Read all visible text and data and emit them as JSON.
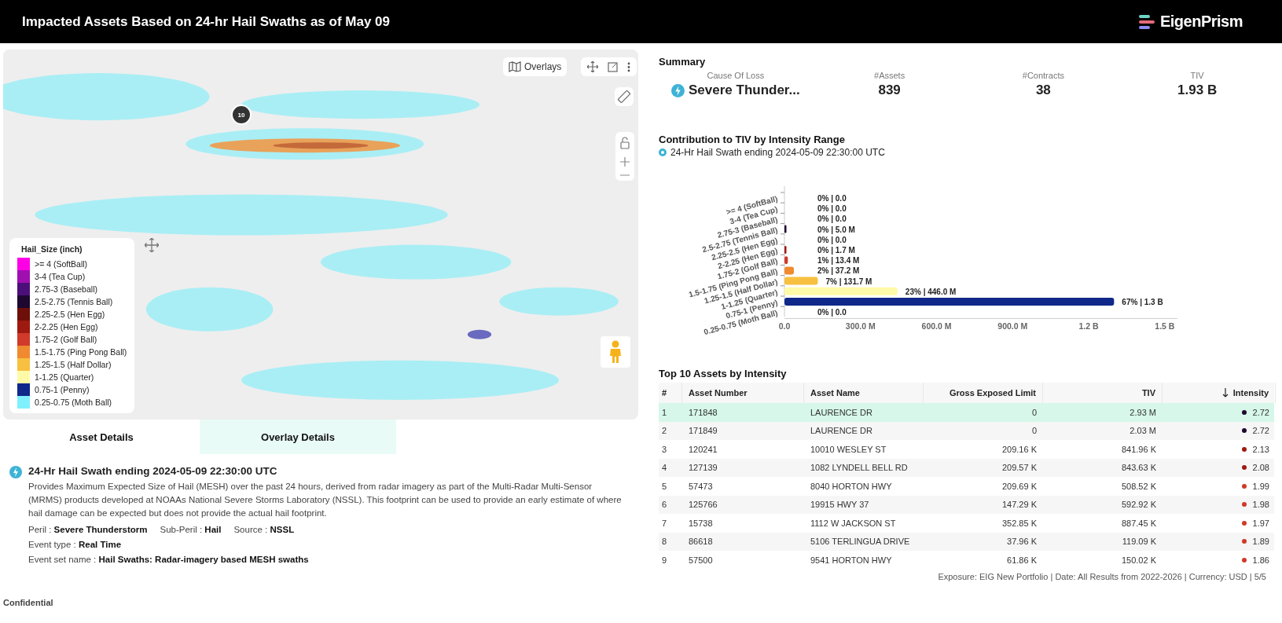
{
  "header": {
    "title": "Impacted Assets Based on 24-hr Hail Swaths as of May 09",
    "logo_text": "EigenPrism"
  },
  "map": {
    "overlays_button": "Overlays",
    "marker_label": "10",
    "legend": {
      "title": "Hail_Size (inch)",
      "items": [
        {
          "label": ">= 4 (SoftBall)",
          "color": "#ff00e6"
        },
        {
          "label": "3-4 (Tea Cup)",
          "color": "#a010b0"
        },
        {
          "label": "2.75-3 (Baseball)",
          "color": "#4b0f7a"
        },
        {
          "label": "2.5-2.75 (Tennis Ball)",
          "color": "#1e0830"
        },
        {
          "label": "2.25-2.5 (Hen Egg)",
          "color": "#6e0f0a"
        },
        {
          "label": "2-2.25 (Hen Egg)",
          "color": "#9e1a10"
        },
        {
          "label": "1.75-2 (Golf Ball)",
          "color": "#d03a2a"
        },
        {
          "label": "1.5-1.75 (Ping Pong Ball)",
          "color": "#f08a30"
        },
        {
          "label": "1.25-1.5 (Half Dollar)",
          "color": "#f7c040"
        },
        {
          "label": "1-1.25 (Quarter)",
          "color": "#fffaa8"
        },
        {
          "label": "0.75-1 (Penny)",
          "color": "#10288a"
        },
        {
          "label": "0.25-0.75 (Moth Ball)",
          "color": "#80f0ff"
        }
      ]
    }
  },
  "detail_tabs": [
    {
      "label": "Asset Details",
      "selected": false
    },
    {
      "label": "Overlay Details",
      "selected": true
    }
  ],
  "overlay_details": {
    "title": "24-Hr Hail Swath ending 2024-05-09 22:30:00 UTC",
    "description": "Provides Maximum Expected Size of Hail (MESH) over the past 24 hours, derived from radar imagery as part of the Multi-Radar Multi-Sensor (MRMS) products developed at NOAAs National Severe Storms Laboratory (NSSL). This footprint can be used to provide an early estimate of where hail damage can be expected but does not provide the actual hail footprint.",
    "facts": [
      [
        "Peril : **Severe Thunderstorm**",
        "Sub-Peril : **Hail**",
        "Source : **NSSL**"
      ],
      [
        "Event type : **Real Time**"
      ],
      [
        "Event set name : **Hail Swaths: Radar-imagery based MESH swaths**"
      ]
    ]
  },
  "footer_left": "Confidential",
  "summary": {
    "title": "Summary",
    "stats": [
      {
        "label": "Cause Of Loss",
        "value": "Severe Thunder...",
        "kind": "peril"
      },
      {
        "label": "#Assets",
        "value": "839",
        "kind": "number"
      },
      {
        "label": "#Contracts",
        "value": "38",
        "kind": "number"
      },
      {
        "label": "TIV",
        "value": "1.93 B",
        "kind": "number"
      }
    ]
  },
  "tiv_chart": {
    "title": "Contribution to TIV by Intensity Range",
    "subtitle": "24-Hr Hail Swath ending 2024-05-09 22:30:00 UTC",
    "chart_data": {
      "type": "bar",
      "orientation": "horizontal",
      "categories": [
        ">= 4 (SoftBall)",
        "3-4 (Tea Cup)",
        "2.75-3 (Baseball)",
        "2.5-2.75 (Tennis Ball)",
        "2.25-2.5 (Hen Egg)",
        "2-2.25 (Hen Egg)",
        "1.75-2 (Golf Ball)",
        "1.5-1.75 (Ping Pong Ball)",
        "1.25-1.5 (Half Dollar)",
        "1-1.25 (Quarter)",
        "0.75-1 (Penny)",
        "0.25-0.75 (Moth Ball)"
      ],
      "series": [
        {
          "values": [
            0,
            0,
            0,
            5000000,
            0,
            1700000,
            13400000,
            37200000,
            131700000,
            446000000,
            1300000000,
            0
          ]
        }
      ],
      "value_labels": [
        "0% | 0.0",
        "0% | 0.0",
        "0% | 0.0",
        "0% | 5.0 M",
        "0% | 0.0",
        "0% | 1.7 M",
        "1% | 13.4 M",
        "2% | 37.2 M",
        "7% | 131.7 M",
        "23% | 446.0 M",
        "67% | 1.3 B",
        "0% | 0.0"
      ],
      "xlim": [
        0,
        1550000000
      ],
      "xticks": [
        {
          "value": 0,
          "label": "0.0"
        },
        {
          "value": 300000000,
          "label": "300.0 M"
        },
        {
          "value": 600000000,
          "label": "600.0 M"
        },
        {
          "value": 900000000,
          "label": "900.0 M"
        },
        {
          "value": 1200000000,
          "label": "1.2 B"
        },
        {
          "value": 1500000000,
          "label": "1.5 B"
        }
      ]
    }
  },
  "top_assets": {
    "title": "Top 10 Assets by Intensity",
    "columns": [
      {
        "label": "#",
        "sorted": false
      },
      {
        "label": "Asset Number",
        "sorted": false
      },
      {
        "label": "Asset Name",
        "sorted": false
      },
      {
        "label": "Gross Exposed Limit",
        "sorted": false
      },
      {
        "label": "TIV",
        "sorted": false
      },
      {
        "label": "Intensity",
        "sorted": true
      }
    ],
    "rows": [
      {
        "cells": [
          "1",
          "171848",
          "LAURENCE DR",
          "0",
          "2.93 M"
        ],
        "intensity": "2.72",
        "color": "#1e0830",
        "selected": true
      },
      {
        "cells": [
          "2",
          "171849",
          "LAURENCE DR",
          "0",
          "2.03 M"
        ],
        "intensity": "2.72",
        "color": "#1e0830",
        "selected": false
      },
      {
        "cells": [
          "3",
          "120241",
          "10010 WESLEY ST",
          "209.16 K",
          "841.96 K"
        ],
        "intensity": "2.13",
        "color": "#9e1a10",
        "selected": false
      },
      {
        "cells": [
          "4",
          "127139",
          "1082 LYNDELL BELL RD",
          "209.57 K",
          "843.63 K"
        ],
        "intensity": "2.08",
        "color": "#9e1a10",
        "selected": false
      },
      {
        "cells": [
          "5",
          "57473",
          "8040 HORTON HWY",
          "209.69 K",
          "508.52 K"
        ],
        "intensity": "1.99",
        "color": "#d03a2a",
        "selected": false
      },
      {
        "cells": [
          "6",
          "125766",
          "19915 HWY 37",
          "147.29 K",
          "592.92 K"
        ],
        "intensity": "1.98",
        "color": "#d03a2a",
        "selected": false
      },
      {
        "cells": [
          "7",
          "15738",
          "1112 W JACKSON ST",
          "352.85 K",
          "887.45 K"
        ],
        "intensity": "1.97",
        "color": "#d03a2a",
        "selected": false
      },
      {
        "cells": [
          "8",
          "86618",
          "5106 TERLINGUA DRIVE",
          "37.96 K",
          "119.09 K"
        ],
        "intensity": "1.89",
        "color": "#d03a2a",
        "selected": false
      },
      {
        "cells": [
          "9",
          "57500",
          "9541 HORTON HWY",
          "61.86 K",
          "150.02 K"
        ],
        "intensity": "1.86",
        "color": "#d03a2a",
        "selected": false
      }
    ]
  },
  "footer_right": "Exposure: EIG New Portfolio | Date: All Results from 2022-2026 | Currency: USD | 5/5"
}
